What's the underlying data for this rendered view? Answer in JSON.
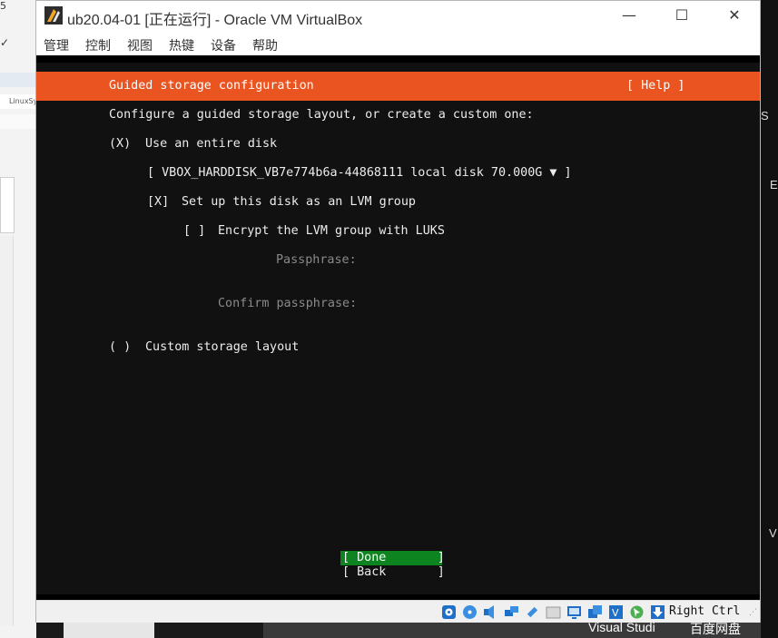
{
  "window": {
    "title": "ub20.04-01 [正在运行] - Oracle VM VirtualBox",
    "minimize_glyph": "—",
    "maximize_glyph": "☐",
    "close_glyph": "✕"
  },
  "menu": [
    "管理",
    "控制",
    "视图",
    "热键",
    "设备",
    "帮助"
  ],
  "installer": {
    "header_title": "Guided storage configuration",
    "help_label": "[ Help ]",
    "intro": "Configure a guided storage layout, or create a custom one:",
    "entire_disk_radio": "(X)",
    "entire_disk_label": "Use an entire disk",
    "disk_select": "[ VBOX_HARDDISK_VB7e774b6a-44868111 local disk 70.000G ▼ ]",
    "lvm_checkbox": "[X]",
    "lvm_label": "Set up this disk as an LVM group",
    "luks_checkbox": "[ ]",
    "luks_label": "Encrypt the LVM group with LUKS",
    "passphrase_label": "Passphrase:",
    "confirm_passphrase_label": "Confirm passphrase:",
    "custom_radio": "( )",
    "custom_label": "Custom storage layout",
    "done_button": "[ Done       ]",
    "back_button": "[ Back       ]"
  },
  "statusbar": {
    "host_key": "Right Ctrl",
    "icons": [
      "hard-disk-icon",
      "optical-drive-icon",
      "audio-icon",
      "network-icon",
      "usb-icon",
      "shared-folders-icon",
      "display-icon",
      "video-capture-icon",
      "recording-icon",
      "cpu-v-icon",
      "mouse-integration-icon",
      "keyboard-capture-icon"
    ]
  },
  "desktop": {
    "left_top_glyph": "5",
    "left_app_text": "LinuxSy",
    "right_letters": [
      "S",
      "E",
      "V"
    ],
    "taskbar_visual_studio": "Visual Studi",
    "taskbar_baidu": "百度网盘"
  },
  "colors": {
    "accent": "#e95420",
    "done_button": "#0e8420",
    "console_bg": "#111111"
  }
}
